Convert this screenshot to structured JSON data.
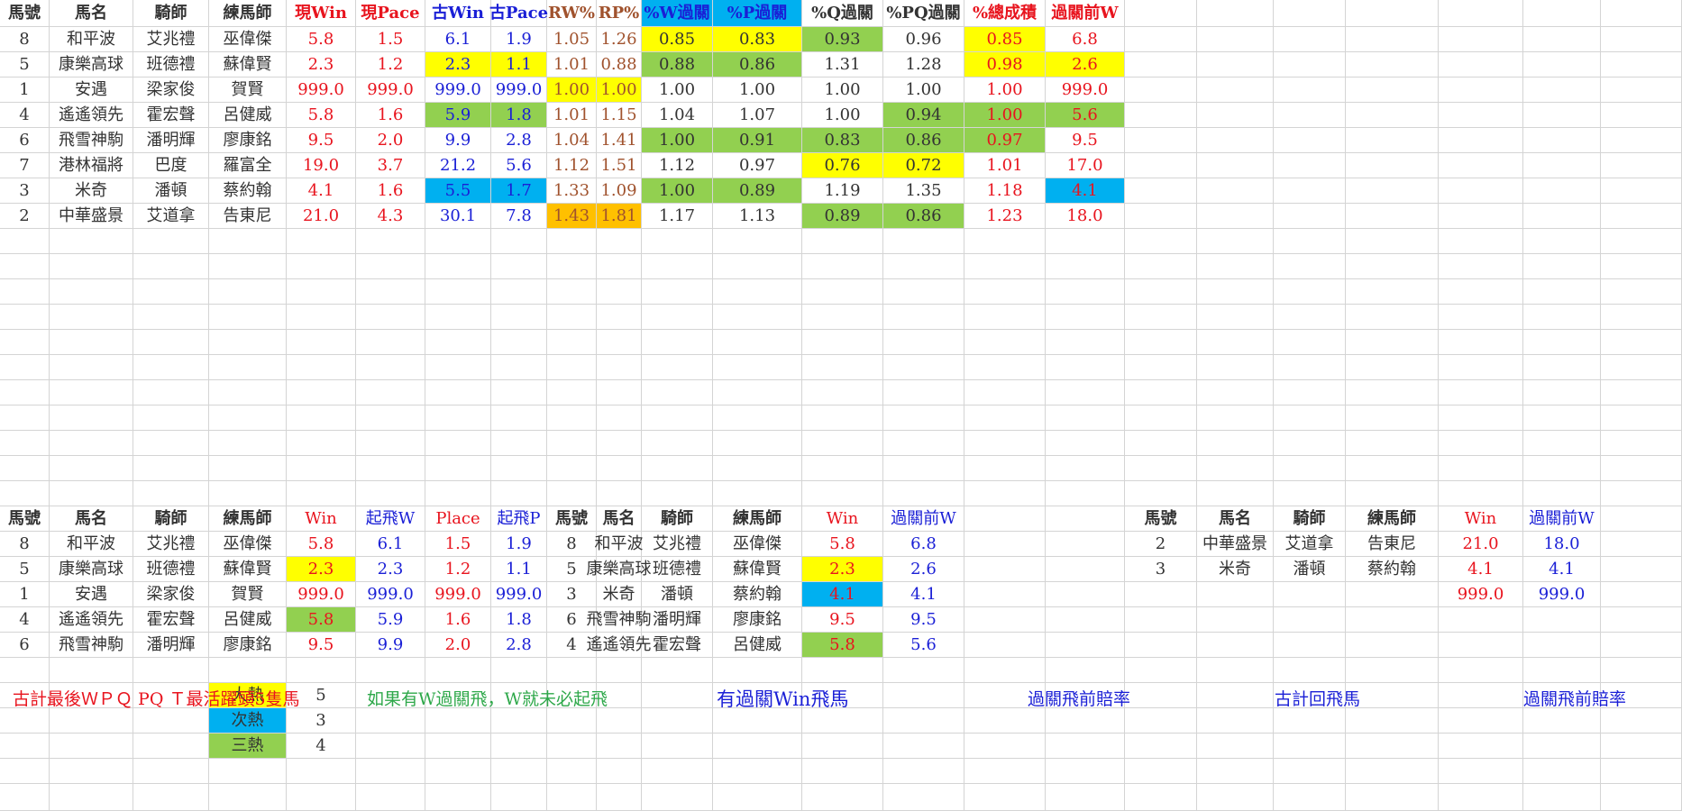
{
  "colors": {
    "red": "#e8141e",
    "blue": "#1a1fd6",
    "brown": "#a0522d",
    "dark": "#333333",
    "green_text": "#2ea84a",
    "hl_yellow": "#ffff00",
    "hl_green": "#92d050",
    "hl_blue": "#00b0f0",
    "hl_orange": "#ffc000"
  },
  "top_table": {
    "headers": [
      {
        "text": "馬號",
        "color": "dark",
        "bold": true
      },
      {
        "text": "馬名",
        "color": "dark",
        "bold": true
      },
      {
        "text": "騎師",
        "color": "dark",
        "bold": true
      },
      {
        "text": "練馬師",
        "color": "dark",
        "bold": true
      },
      {
        "text": "現Win",
        "color": "red",
        "bold": true
      },
      {
        "text": "現Pace",
        "color": "red",
        "bold": true
      },
      {
        "text": "古Win",
        "color": "blue",
        "bold": true
      },
      {
        "text": "古Pace",
        "color": "blue",
        "bold": true
      },
      {
        "text": "RW%",
        "color": "brown",
        "bold": true
      },
      {
        "text": "RP%",
        "color": "brown",
        "bold": true
      },
      {
        "text": "%W過關",
        "color": "blue",
        "bold": true,
        "bg": "hl_blue"
      },
      {
        "text": "%P過關",
        "color": "blue",
        "bold": true,
        "bg": "hl_blue"
      },
      {
        "text": "%Q過關",
        "color": "dark",
        "bold": true
      },
      {
        "text": "%PQ過關",
        "color": "dark",
        "bold": true
      },
      {
        "text": "%總成積",
        "color": "red",
        "bold": true
      },
      {
        "text": "過關前W",
        "color": "red",
        "bold": true
      }
    ],
    "col_colors": [
      "dark",
      "dark",
      "dark",
      "dark",
      "red",
      "red",
      "blue",
      "blue",
      "brown",
      "brown",
      "dark",
      "dark",
      "dark",
      "dark",
      "red",
      "red"
    ],
    "rows": [
      {
        "cells": [
          "8",
          "和平波",
          "艾兆禮",
          "巫偉傑",
          "5.8",
          "1.5",
          "6.1",
          "1.9",
          "1.05",
          "1.26",
          "0.85",
          "0.83",
          "0.93",
          "0.96",
          "0.85",
          "6.8"
        ],
        "bg": {
          "10": "hl_yellow",
          "11": "hl_yellow",
          "12": "hl_green",
          "14": "hl_yellow"
        }
      },
      {
        "cells": [
          "5",
          "康樂高球",
          "班德禮",
          "蘇偉賢",
          "2.3",
          "1.2",
          "2.3",
          "1.1",
          "1.01",
          "0.88",
          "0.88",
          "0.86",
          "1.31",
          "1.28",
          "0.98",
          "2.6"
        ],
        "bg": {
          "6": "hl_yellow",
          "7": "hl_yellow",
          "10": "hl_green",
          "11": "hl_green",
          "14": "hl_yellow",
          "15": "hl_yellow"
        }
      },
      {
        "cells": [
          "1",
          "安遇",
          "梁家俊",
          "賀賢",
          "999.0",
          "999.0",
          "999.0",
          "999.0",
          "1.00",
          "1.00",
          "1.00",
          "1.00",
          "1.00",
          "1.00",
          "1.00",
          "999.0"
        ],
        "bg": {
          "8": "hl_yellow",
          "9": "hl_yellow"
        }
      },
      {
        "cells": [
          "4",
          "遙遙領先",
          "霍宏聲",
          "呂健威",
          "5.8",
          "1.6",
          "5.9",
          "1.8",
          "1.01",
          "1.15",
          "1.04",
          "1.07",
          "1.00",
          "0.94",
          "1.00",
          "5.6"
        ],
        "bg": {
          "6": "hl_green",
          "7": "hl_green",
          "13": "hl_green",
          "14": "hl_green",
          "15": "hl_green"
        }
      },
      {
        "cells": [
          "6",
          "飛雪神駒",
          "潘明輝",
          "廖康銘",
          "9.5",
          "2.0",
          "9.9",
          "2.8",
          "1.04",
          "1.41",
          "1.00",
          "0.91",
          "0.83",
          "0.86",
          "0.97",
          "9.5"
        ],
        "bg": {
          "10": "hl_green",
          "11": "hl_green",
          "12": "hl_green",
          "13": "hl_green",
          "14": "hl_green"
        }
      },
      {
        "cells": [
          "7",
          "港林福將",
          "巴度",
          "羅富全",
          "19.0",
          "3.7",
          "21.2",
          "5.6",
          "1.12",
          "1.51",
          "1.12",
          "0.97",
          "0.76",
          "0.72",
          "1.01",
          "17.0"
        ],
        "bg": {
          "12": "hl_yellow",
          "13": "hl_yellow"
        }
      },
      {
        "cells": [
          "3",
          "米奇",
          "潘頓",
          "蔡約翰",
          "4.1",
          "1.6",
          "5.5",
          "1.7",
          "1.33",
          "1.09",
          "1.00",
          "0.89",
          "1.19",
          "1.35",
          "1.18",
          "4.1"
        ],
        "bg": {
          "6": "hl_blue",
          "7": "hl_blue",
          "10": "hl_green",
          "11": "hl_green",
          "15": "hl_blue"
        }
      },
      {
        "cells": [
          "2",
          "中華盛景",
          "艾道拿",
          "告東尼",
          "21.0",
          "4.3",
          "30.1",
          "7.8",
          "1.43",
          "1.81",
          "1.17",
          "1.13",
          "0.89",
          "0.86",
          "1.23",
          "18.0"
        ],
        "bg": {
          "8": "hl_orange",
          "9": "hl_orange",
          "12": "hl_green",
          "13": "hl_green"
        }
      }
    ]
  },
  "bottom_left_table": {
    "headers": [
      {
        "text": "馬號",
        "color": "dark",
        "bold": true
      },
      {
        "text": "馬名",
        "color": "dark",
        "bold": true
      },
      {
        "text": "騎師",
        "color": "dark",
        "bold": true
      },
      {
        "text": "練馬師",
        "color": "dark",
        "bold": true
      },
      {
        "text": "Win",
        "color": "red",
        "bold": false
      },
      {
        "text": "起飛W",
        "color": "blue",
        "bold": false
      },
      {
        "text": "Place",
        "color": "red",
        "bold": false
      },
      {
        "text": "起飛P",
        "color": "blue",
        "bold": false
      }
    ],
    "col_colors": [
      "dark",
      "dark",
      "dark",
      "dark",
      "red",
      "blue",
      "red",
      "blue"
    ],
    "rows": [
      {
        "cells": [
          "8",
          "和平波",
          "艾兆禮",
          "巫偉傑",
          "5.8",
          "6.1",
          "1.5",
          "1.9"
        ],
        "bg": {}
      },
      {
        "cells": [
          "5",
          "康樂高球",
          "班德禮",
          "蘇偉賢",
          "2.3",
          "2.3",
          "1.2",
          "1.1"
        ],
        "bg": {
          "4": "hl_yellow"
        }
      },
      {
        "cells": [
          "1",
          "安遇",
          "梁家俊",
          "賀賢",
          "999.0",
          "999.0",
          "999.0",
          "999.0"
        ],
        "bg": {}
      },
      {
        "cells": [
          "4",
          "遙遙領先",
          "霍宏聲",
          "呂健威",
          "5.8",
          "5.9",
          "1.6",
          "1.8"
        ],
        "bg": {
          "4": "hl_green"
        }
      },
      {
        "cells": [
          "6",
          "飛雪神駒",
          "潘明輝",
          "廖康銘",
          "9.5",
          "9.9",
          "2.0",
          "2.8"
        ],
        "bg": {}
      }
    ]
  },
  "bottom_mid_table": {
    "headers": [
      {
        "text": "馬號",
        "color": "dark",
        "bold": true
      },
      {
        "text": "馬名",
        "color": "dark",
        "bold": true
      },
      {
        "text": "騎師",
        "color": "dark",
        "bold": true
      },
      {
        "text": "練馬師",
        "color": "dark",
        "bold": true
      },
      {
        "text": "Win",
        "color": "red",
        "bold": false
      },
      {
        "text": "過關前W",
        "color": "blue",
        "bold": false
      }
    ],
    "col_colors": [
      "dark",
      "dark",
      "dark",
      "dark",
      "red",
      "blue"
    ],
    "rows": [
      {
        "cells": [
          "8",
          "和平波",
          "艾兆禮",
          "巫偉傑",
          "5.8",
          "6.8"
        ],
        "bg": {}
      },
      {
        "cells": [
          "5",
          "康樂高球",
          "班德禮",
          "蘇偉賢",
          "2.3",
          "2.6"
        ],
        "bg": {
          "4": "hl_yellow"
        }
      },
      {
        "cells": [
          "3",
          "米奇",
          "潘頓",
          "蔡約翰",
          "4.1",
          "4.1"
        ],
        "bg": {
          "4": "hl_blue"
        }
      },
      {
        "cells": [
          "6",
          "飛雪神駒",
          "潘明輝",
          "廖康銘",
          "9.5",
          "9.5"
        ],
        "bg": {}
      },
      {
        "cells": [
          "4",
          "遙遙領先",
          "霍宏聲",
          "呂健威",
          "5.8",
          "5.6"
        ],
        "bg": {
          "4": "hl_green"
        }
      }
    ]
  },
  "bottom_right_table": {
    "headers": [
      {
        "text": "馬號",
        "color": "dark",
        "bold": true
      },
      {
        "text": "馬名",
        "color": "dark",
        "bold": true
      },
      {
        "text": "騎師",
        "color": "dark",
        "bold": true
      },
      {
        "text": "練馬師",
        "color": "dark",
        "bold": true
      },
      {
        "text": "Win",
        "color": "red",
        "bold": false
      },
      {
        "text": "過關前W",
        "color": "blue",
        "bold": false
      }
    ],
    "col_colors": [
      "dark",
      "dark",
      "dark",
      "dark",
      "red",
      "blue"
    ],
    "rows": [
      {
        "cells": [
          "2",
          "中華盛景",
          "艾道拿",
          "告東尼",
          "21.0",
          "18.0"
        ],
        "bg": {}
      },
      {
        "cells": [
          "3",
          "米奇",
          "潘頓",
          "蔡約翰",
          "4.1",
          "4.1"
        ],
        "bg": {}
      },
      {
        "cells": [
          "",
          "",
          "",
          "",
          "999.0",
          "999.0"
        ],
        "bg": {}
      }
    ]
  },
  "notes": {
    "note1": "古計最後ＷＰＱ PQ Ｔ最活躍頭5隻馬",
    "note2": "如果有W過關飛，W就未必起飛",
    "note3": "有過關Win飛馬",
    "note4": "過關飛前賠率",
    "note5": "古計回飛馬",
    "note6": "過關飛前賠率"
  },
  "legend": [
    {
      "label": "大熱",
      "value": "5",
      "bg": "hl_yellow"
    },
    {
      "label": "次熱",
      "value": "3",
      "bg": "hl_blue"
    },
    {
      "label": "三熱",
      "value": "4",
      "bg": "hl_green"
    }
  ]
}
